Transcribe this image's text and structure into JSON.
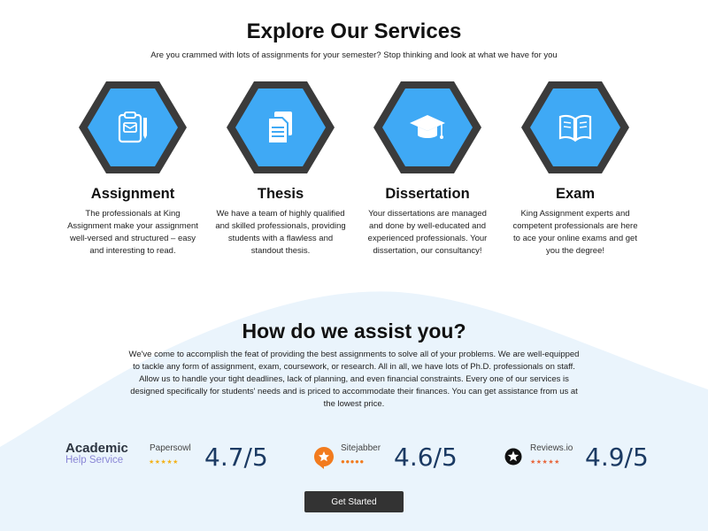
{
  "colors": {
    "accent_blue": "#3fa9f5",
    "hex_border": "#3b3b3b",
    "background_blob": "#eaf4fc",
    "score_text": "#1b3a63",
    "button_bg": "#333333",
    "star_gold": "#f3b21a",
    "star_red": "#e8663b"
  },
  "services_section": {
    "title": "Explore Our Services",
    "subtitle": "Are you crammed with lots of assignments for your semester? Stop thinking and look at what we have for you"
  },
  "services": [
    {
      "icon": "clipboard-icon",
      "title": "Assignment",
      "description": "The professionals at King Assignment make your assignment well-versed and structured – easy and interesting to read."
    },
    {
      "icon": "document-icon",
      "title": "Thesis",
      "description": "We have a team of highly qualified and skilled professionals, providing students with a flawless and standout thesis."
    },
    {
      "icon": "graduation-cap-icon",
      "title": "Dissertation",
      "description": "Your dissertations are managed and done by well-educated and experienced professionals. Your dissertation, our consultancy!"
    },
    {
      "icon": "open-book-icon",
      "title": "Exam",
      "description": "King Assignment experts and competent professionals are here to ace your online exams and get you the degree!"
    }
  ],
  "assist_section": {
    "title": "How do we assist you?",
    "paragraph": "We've come to accomplish the feat of providing the best assignments to solve all of your problems. We are well-equipped to tackle any form of assignment, exam, coursework, or research. All in all, we have lots of Ph.D. professionals on staff. Allow us to handle your tight deadlines, lack of planning, and even financial constraints. Every one of our services is designed specifically for students' needs and is priced to accommodate their finances. You can get assistance from us at the lowest price."
  },
  "reviews": {
    "academic_logo": {
      "line1": "Academic",
      "line2": "Help Service"
    },
    "items": [
      {
        "brand": "Papersowl",
        "icon": "papersowl-icon",
        "stars": "★★★★★",
        "score": "4.7/5"
      },
      {
        "brand": "Sitejabber",
        "icon": "sitejabber-icon",
        "stars": "●●●●●",
        "score": "4.6/5"
      },
      {
        "brand": "Reviews.io",
        "icon": "reviews-io-icon",
        "stars": "★★★★★",
        "score": "4.9/5"
      }
    ]
  },
  "cta": {
    "label": "Get Started"
  }
}
